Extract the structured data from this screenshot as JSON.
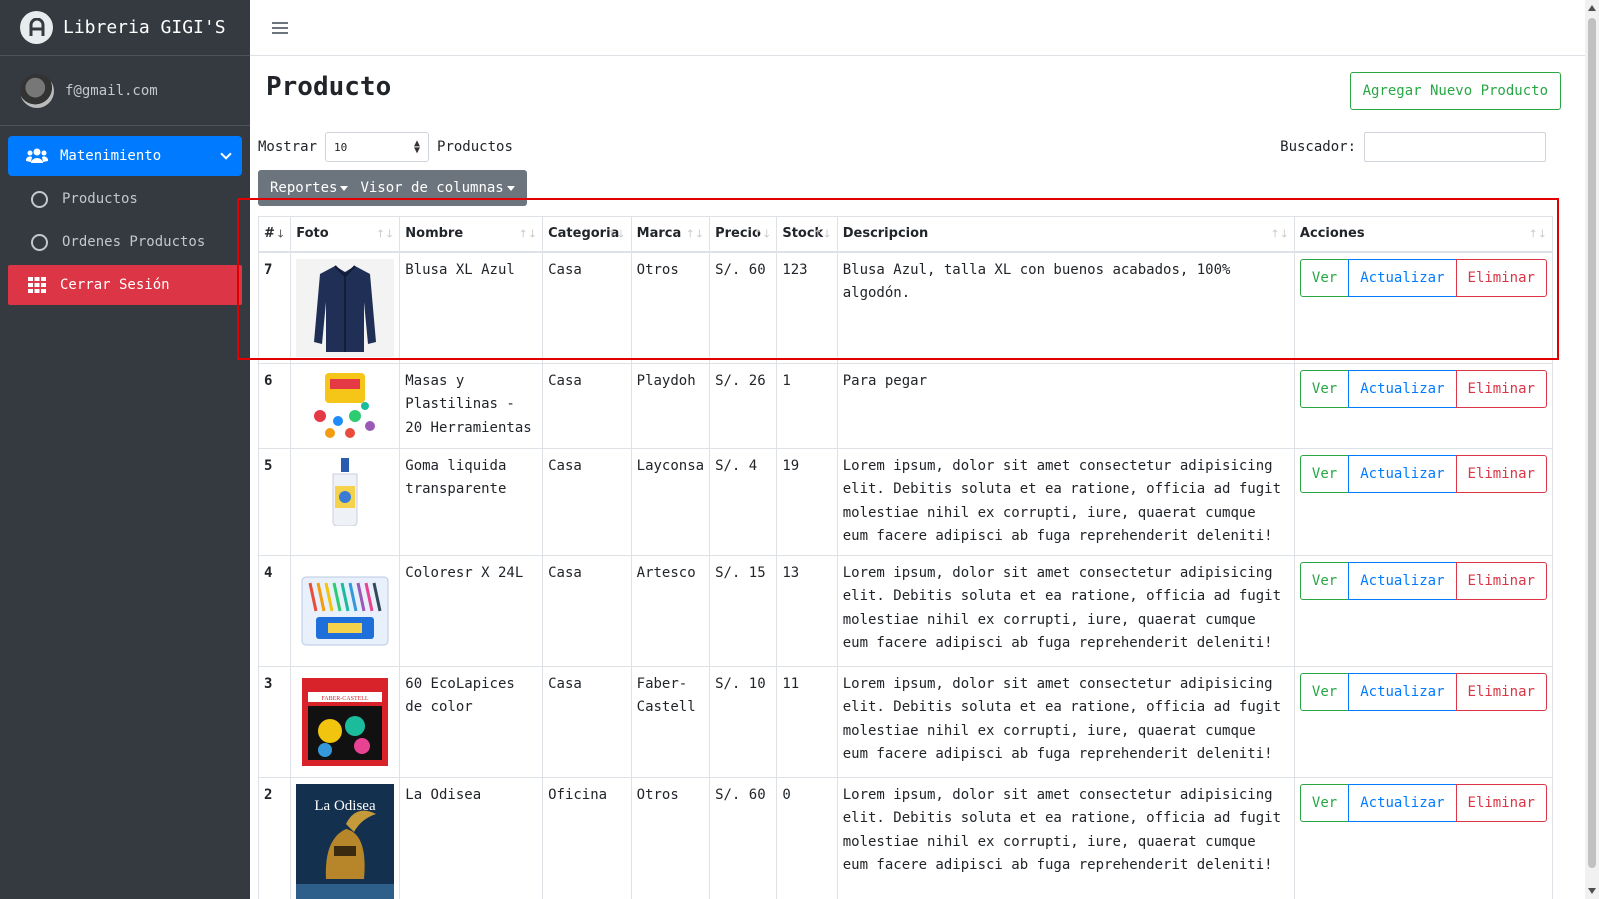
{
  "app": {
    "brand": "Libreria GIGI'S"
  },
  "user": {
    "email": "f@gmail.com"
  },
  "sidebar": {
    "items": [
      {
        "label": "Matenimiento",
        "icon": "users-icon"
      },
      {
        "label": "Productos",
        "icon": "circle-icon"
      },
      {
        "label": "Ordenes Productos",
        "icon": "circle-icon"
      },
      {
        "label": "Cerrar Sesión",
        "icon": "grid-icon"
      }
    ]
  },
  "page": {
    "title": "Producto",
    "add_button": "Agregar Nuevo Producto",
    "show_label": "Mostrar",
    "show_value": "10",
    "show_suffix": "Productos",
    "search_label": "Buscador:",
    "search_value": "",
    "reports_label": "Reportes",
    "columns_label": "Visor de columnas"
  },
  "table": {
    "headers": [
      "#",
      "Foto",
      "Nombre",
      "Categoria",
      "Marca",
      "Precio",
      "Stock",
      "Descripcion",
      "Acciones"
    ],
    "action_labels": {
      "view": "Ver",
      "update": "Actualizar",
      "delete": "Eliminar"
    },
    "rows": [
      {
        "id": "7",
        "image": "shirt",
        "nombre": "Blusa XL Azul",
        "categoria": "Casa",
        "marca": "Otros",
        "precio": "S/. 60",
        "stock": "123",
        "descripcion": "Blusa Azul, talla XL con buenos acabados, 100% algodón."
      },
      {
        "id": "6",
        "image": "playdoh",
        "nombre": "Masas y Plastilinas - 20 Herramientas",
        "categoria": "Casa",
        "marca": "Playdoh",
        "precio": "S/. 26",
        "stock": "1",
        "descripcion": "Para pegar"
      },
      {
        "id": "5",
        "image": "glue",
        "nombre": "Goma liquida transparente",
        "categoria": "Casa",
        "marca": "Layconsa",
        "precio": "S/. 4",
        "stock": "19",
        "descripcion": "Lorem ipsum, dolor sit amet consectetur adipisicing elit. Debitis soluta et ea ratione, officia ad fugit molestiae nihil ex corrupti, iure, quaerat cumque eum facere adipisci ab fuga reprehenderit deleniti!"
      },
      {
        "id": "4",
        "image": "colors",
        "nombre": "Coloresr X 24L",
        "categoria": "Casa",
        "marca": "Artesco",
        "precio": "S/. 15",
        "stock": "13",
        "descripcion": "Lorem ipsum, dolor sit amet consectetur adipisicing elit. Debitis soluta et ea ratione, officia ad fugit molestiae nihil ex corrupti, iure, quaerat cumque eum facere adipisci ab fuga reprehenderit deleniti!"
      },
      {
        "id": "3",
        "image": "faber",
        "image_text": "FABER-CASTELL",
        "nombre": "60 EcoLapices de color",
        "categoria": "Casa",
        "marca": "Faber-Castell",
        "precio": "S/. 10",
        "stock": "11",
        "descripcion": "Lorem ipsum, dolor sit amet consectetur adipisicing elit. Debitis soluta et ea ratione, officia ad fugit molestiae nihil ex corrupti, iure, quaerat cumque eum facere adipisci ab fuga reprehenderit deleniti!"
      },
      {
        "id": "2",
        "image": "book",
        "image_text": "La Odisea",
        "nombre": "La Odisea",
        "categoria": "Oficina",
        "marca": "Otros",
        "precio": "S/. 60",
        "stock": "0",
        "descripcion": "Lorem ipsum, dolor sit amet consectetur adipisicing elit. Debitis soluta et ea ratione, officia ad fugit molestiae nihil ex corrupti, iure, quaerat cumque eum facere adipisci ab fuga reprehenderit deleniti!"
      }
    ]
  },
  "colors": {
    "sidebar": "#343a40",
    "primary": "#007bff",
    "success": "#28a745",
    "danger": "#dc3545",
    "highlight": "#e00000"
  }
}
